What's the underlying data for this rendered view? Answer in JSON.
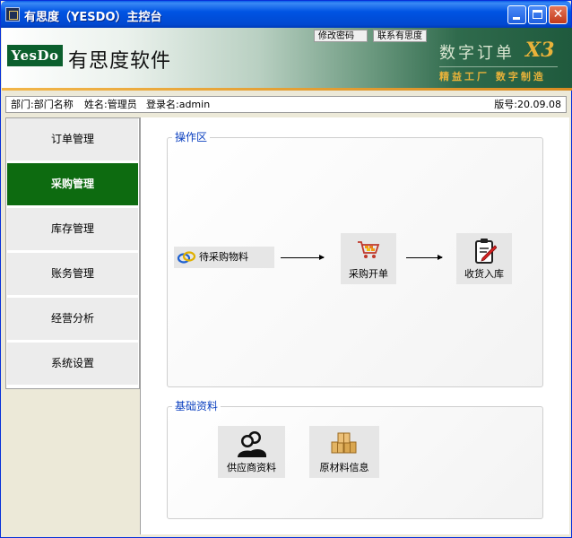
{
  "window": {
    "title": "有思度（YESDO）主控台",
    "minimize_label": "",
    "maximize_label": "",
    "close_label": "✕"
  },
  "header": {
    "logo_text": "YesDo",
    "brand_name": "有思度软件",
    "change_password": "修改密码",
    "contact": "联系有思度",
    "slogan_main": "数字订单",
    "slogan_version": "X3",
    "slogan_sub": "精益工厂 数字制造"
  },
  "info": {
    "department": "部门:部门名称",
    "name": "姓名:管理员",
    "login": "登录名:admin",
    "version": "版号:20.09.08"
  },
  "sidebar": {
    "items": [
      {
        "label": "订单管理",
        "active": false
      },
      {
        "label": "采购管理",
        "active": true
      },
      {
        "label": "库存管理",
        "active": false
      },
      {
        "label": "账务管理",
        "active": false
      },
      {
        "label": "经营分析",
        "active": false
      },
      {
        "label": "系统设置",
        "active": false
      }
    ]
  },
  "operations": {
    "title": "操作区",
    "pending_materials": "待采购物料",
    "purchase_order": "采购开单",
    "receiving": "收货入库"
  },
  "basic_data": {
    "title": "基础资料",
    "supplier": "供应商资料",
    "raw_materials": "原材料信息"
  },
  "colors": {
    "active_nav": "#0d6b10",
    "group_title": "#0a3fbf",
    "banner_dark": "#1f5a3d",
    "accent_gold": "#e8b23a"
  },
  "icons": {
    "pending": "link-rings-icon",
    "purchase": "shopping-cart-icon",
    "receiving": "clipboard-check-icon",
    "supplier": "users-icon",
    "materials": "boxes-icon"
  }
}
